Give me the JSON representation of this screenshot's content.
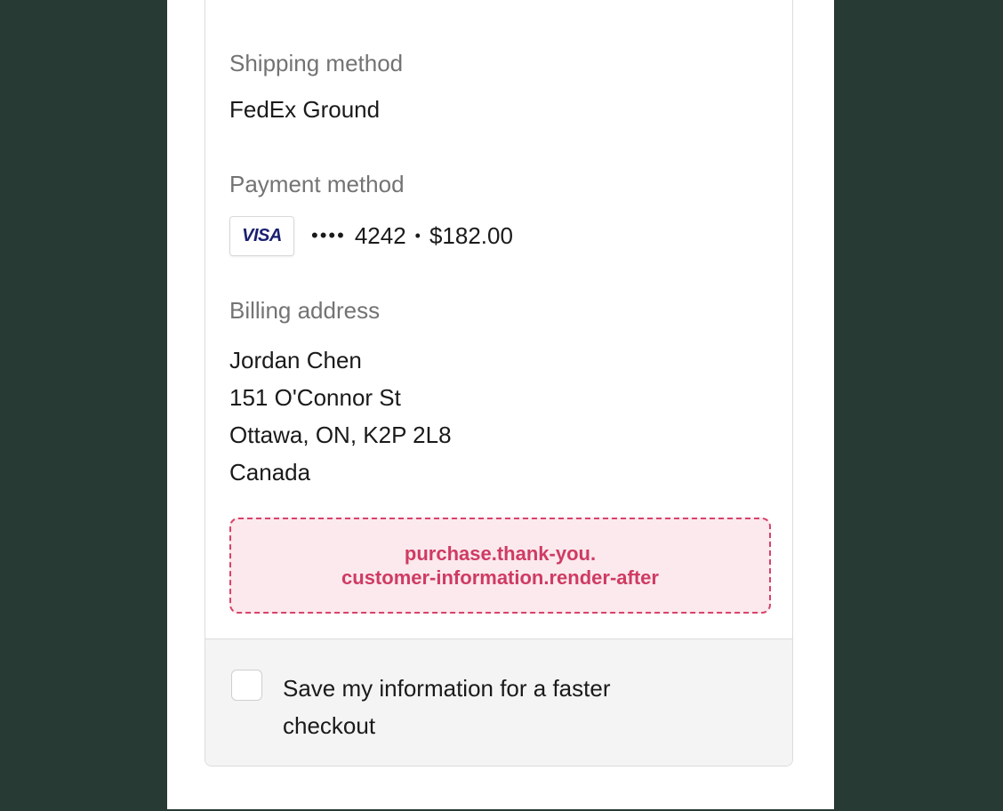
{
  "shipping": {
    "label": "Shipping method",
    "value": "FedEx Ground"
  },
  "payment": {
    "label": "Payment method",
    "card_brand": "VISA",
    "masked_digits": "••••",
    "last4": "4242",
    "separator": "•",
    "amount": "$182.00"
  },
  "billing": {
    "label": "Billing address",
    "lines": [
      "Jordan Chen",
      "151 O'Connor St",
      "Ottawa, ON, K2P 2L8",
      "Canada"
    ]
  },
  "extension": {
    "line1": "purchase.thank-you.",
    "line2": "customer-information.render-after"
  },
  "save_info": {
    "label": "Save my information for a faster checkout",
    "checked": false
  },
  "colors": {
    "background": "#283a34",
    "extension_border": "#d8426a",
    "extension_text": "#cf3b63",
    "visa_blue": "#1a1f71"
  }
}
